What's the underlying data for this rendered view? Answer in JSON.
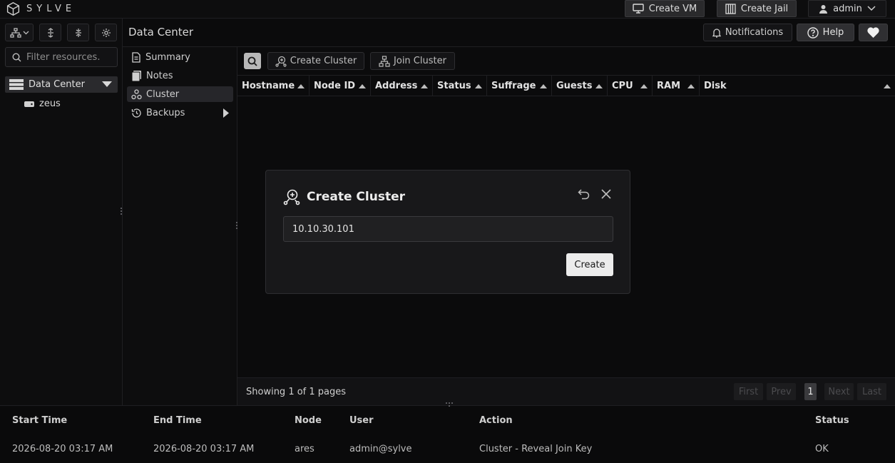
{
  "app": {
    "brand": "SYLVE"
  },
  "topbar": {
    "create_vm": "Create VM",
    "create_jail": "Create Jail",
    "user": "admin"
  },
  "sidebar": {
    "filter_placeholder": "Filter resources.",
    "tree_root": "Data Center",
    "tree_node": "zeus"
  },
  "header": {
    "title": "Data Center",
    "notifications": "Notifications",
    "help": "Help"
  },
  "nav": {
    "items": [
      "Summary",
      "Notes",
      "Cluster",
      "Backups"
    ],
    "active": "Cluster"
  },
  "toolbar": {
    "create_cluster": "Create Cluster",
    "join_cluster": "Join Cluster"
  },
  "table": {
    "columns": [
      "Hostname",
      "Node ID",
      "Address",
      "Status",
      "Suffrage",
      "Guests",
      "CPU",
      "RAM",
      "Disk"
    ]
  },
  "pager": {
    "summary": "Showing 1 of 1 pages",
    "first": "First",
    "prev": "Prev",
    "current": "1",
    "next": "Next",
    "last": "Last"
  },
  "log": {
    "headers": [
      "Start Time",
      "End Time",
      "Node",
      "User",
      "Action",
      "Status"
    ],
    "row": [
      "2026-08-20 03:17 AM",
      "2026-08-20 03:17 AM",
      "ares",
      "admin@sylve",
      "Cluster - Reveal Join Key",
      "OK"
    ]
  },
  "modal": {
    "title": "Create Cluster",
    "input_value": "10.10.30.101",
    "submit": "Create"
  },
  "colors": {
    "background": "#0a0a0b",
    "panel": "#18181a",
    "accent": "#ececec"
  }
}
